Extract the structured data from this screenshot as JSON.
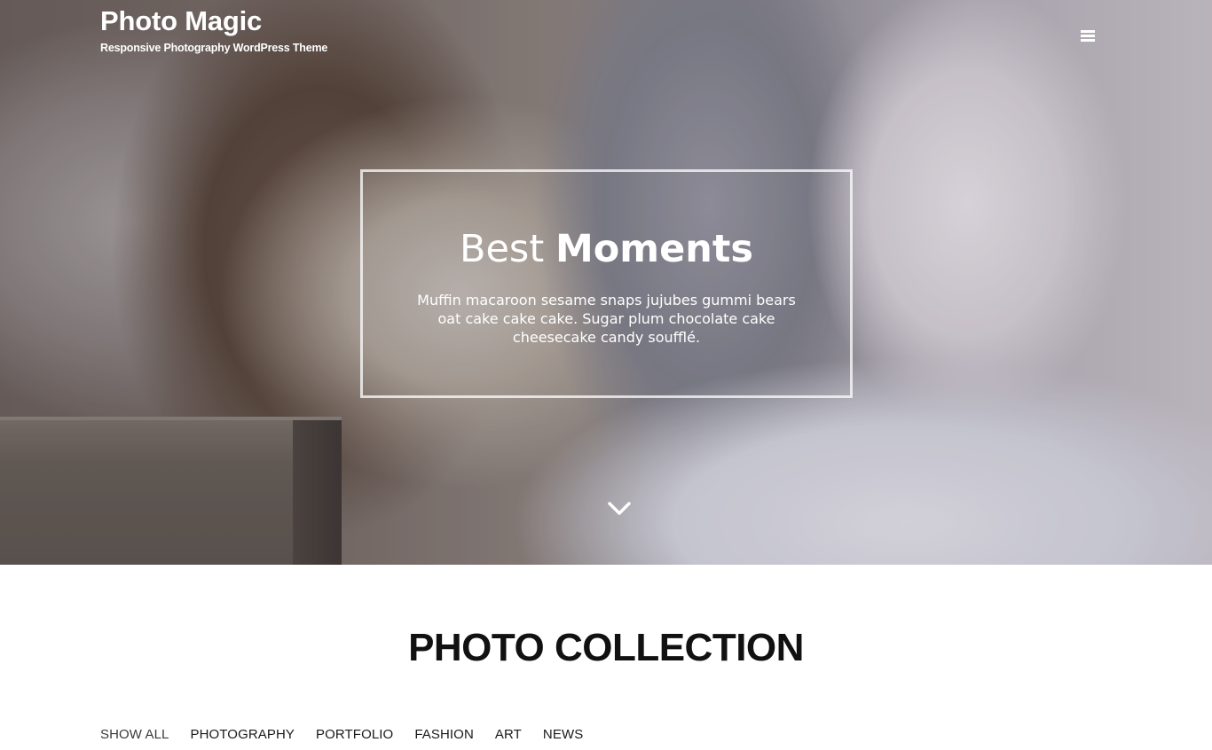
{
  "header": {
    "site_title": "Photo Magic",
    "tagline": "Responsive Photography WordPress Theme",
    "menu_icon": "hamburger-menu-icon"
  },
  "hero": {
    "heading_light": "Best",
    "heading_bold": "Moments",
    "text": "Muffin macaroon sesame snaps jujubes gummi bears oat cake cake cake. Sugar plum chocolate cake cheesecake candy soufflé.",
    "scroll_icon": "chevron-down-icon"
  },
  "collection": {
    "title": "PHOTO COLLECTION",
    "filters": [
      {
        "label": "SHOW ALL",
        "active": true
      },
      {
        "label": "PHOTOGRAPHY",
        "active": false
      },
      {
        "label": "PORTFOLIO",
        "active": false
      },
      {
        "label": "FASHION",
        "active": false
      },
      {
        "label": "ART",
        "active": false
      },
      {
        "label": "NEWS",
        "active": false
      }
    ]
  },
  "colors": {
    "text_dark": "#111111",
    "white": "#ffffff"
  }
}
